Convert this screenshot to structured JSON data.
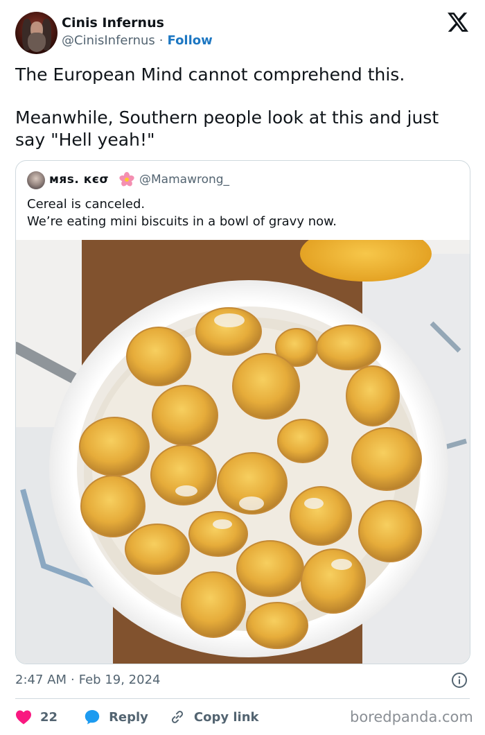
{
  "author": {
    "name": "Cinis Infernus",
    "handle": "@CinisInfernus",
    "separator": "·",
    "follow_label": "Follow"
  },
  "tweet": {
    "paragraphs": [
      "The European Mind cannot comprehend this.",
      "Meanwhile, Southern people look at this and just say \"Hell yeah!\""
    ]
  },
  "quote": {
    "name": "мяѕ. кєσ",
    "handle": "@Mamawrong_",
    "lines": [
      "Cereal is canceled.",
      "We’re eating mini biscuits in a bowl of gravy now."
    ]
  },
  "meta": {
    "time": "2:47 AM",
    "separator": "·",
    "date": "Feb 19, 2024"
  },
  "actions": {
    "likes": "22",
    "reply_label": "Reply",
    "copy_label": "Copy link"
  },
  "icons": {
    "platform": "x-logo-icon",
    "info": "info-icon",
    "like": "heart-icon",
    "reply": "reply-bubble-icon",
    "copy": "link-icon",
    "badge": "flower-emoji-icon"
  },
  "colors": {
    "accent": "#1d77c2",
    "like": "#f91880",
    "reply": "#1d9bf0",
    "muted": "#536471",
    "border": "#cfd9de"
  },
  "watermark": "boredpanda.com"
}
